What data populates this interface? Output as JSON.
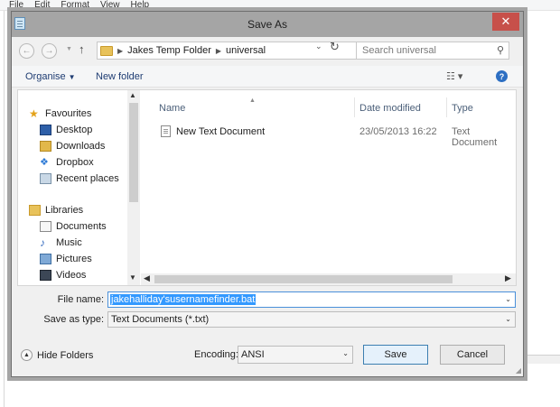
{
  "menu": [
    "File",
    "Edit",
    "Format",
    "View",
    "Help"
  ],
  "dialog": {
    "title": "Save As",
    "close_label": "✕"
  },
  "address": {
    "crumbs": [
      "Jakes Temp Folder",
      "universal"
    ],
    "search_placeholder": "Search universal"
  },
  "toolbar": {
    "organise_label": "Organise",
    "new_folder_label": "New folder"
  },
  "navigation": {
    "favourites_header": "Favourites",
    "favourites": [
      "Desktop",
      "Downloads",
      "Dropbox",
      "Recent places"
    ],
    "libraries_header": "Libraries",
    "libraries": [
      "Documents",
      "Music",
      "Pictures",
      "Videos"
    ]
  },
  "files": {
    "columns": [
      "Name",
      "Date modified",
      "Type"
    ],
    "rows": [
      {
        "name": "New Text Document",
        "date": "23/05/2013 16:22",
        "type": "Text Document"
      }
    ]
  },
  "form": {
    "file_name_label": "File name:",
    "file_name_value": "jakehalliday'susernamefinder.bat",
    "save_type_label": "Save as type:",
    "save_type_value": "Text Documents (*.txt)",
    "encoding_label": "Encoding:",
    "encoding_value": "ANSI"
  },
  "buttons": {
    "hide_folders": "Hide Folders",
    "save": "Save",
    "cancel": "Cancel"
  },
  "colors": {
    "close_button": "#c7504a",
    "titlebar": "#a5a5a5",
    "selection": "#3399ff",
    "link_blue": "#1e3c72"
  }
}
